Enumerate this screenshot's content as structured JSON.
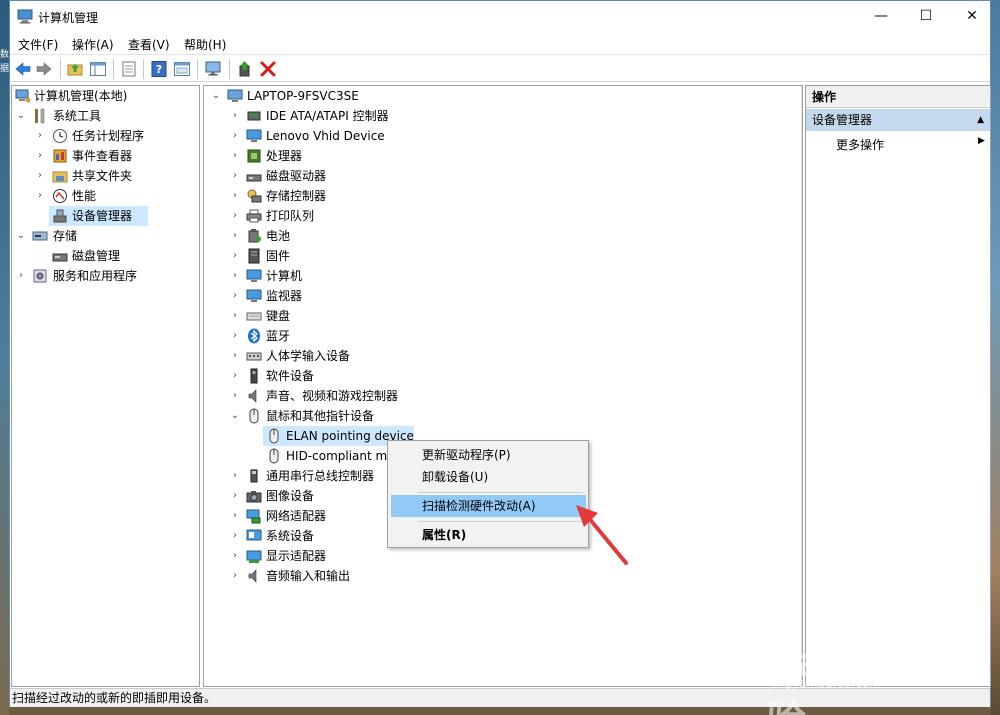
{
  "window": {
    "title": "计算机管理",
    "minimize": "—",
    "maximize": "☐",
    "close": "✕"
  },
  "menu": [
    "文件(F)",
    "操作(A)",
    "查看(V)",
    "帮助(H)"
  ],
  "left_tree": {
    "root": "计算机管理(本地)",
    "system_tools": "系统工具",
    "task_scheduler": "任务计划程序",
    "event_viewer": "事件查看器",
    "shared_folders": "共享文件夹",
    "performance": "性能",
    "device_manager": "设备管理器",
    "storage": "存储",
    "disk_management": "磁盘管理",
    "services_apps": "服务和应用程序"
  },
  "device_tree": {
    "root": "LAPTOP-9FSVC3SE",
    "categories": [
      "IDE ATA/ATAPI 控制器",
      "Lenovo Vhid Device",
      "处理器",
      "磁盘驱动器",
      "存储控制器",
      "打印队列",
      "电池",
      "固件",
      "计算机",
      "监视器",
      "键盘",
      "蓝牙",
      "人体学输入设备",
      "软件设备",
      "声音、视频和游戏控制器",
      "鼠标和其他指针设备"
    ],
    "mouse_children": [
      "ELAN pointing device",
      "HID-compliant mo"
    ],
    "after": [
      "通用串行总线控制器",
      "图像设备",
      "网络适配器",
      "系统设备",
      "显示适配器",
      "音频输入和输出"
    ]
  },
  "actions": {
    "header": "操作",
    "section": "设备管理器",
    "more": "更多操作"
  },
  "context_menu": {
    "update_driver": "更新驱动程序(P)",
    "uninstall": "卸载设备(U)",
    "scan": "扫描检测硬件改动(A)",
    "properties": "属性(R)"
  },
  "status": "扫描经过改动的或新的即插即用设备。",
  "watermark": {
    "text": "Bai du 经验",
    "url": "jingyan.baidu.com"
  },
  "desktop_left_text": "数据"
}
